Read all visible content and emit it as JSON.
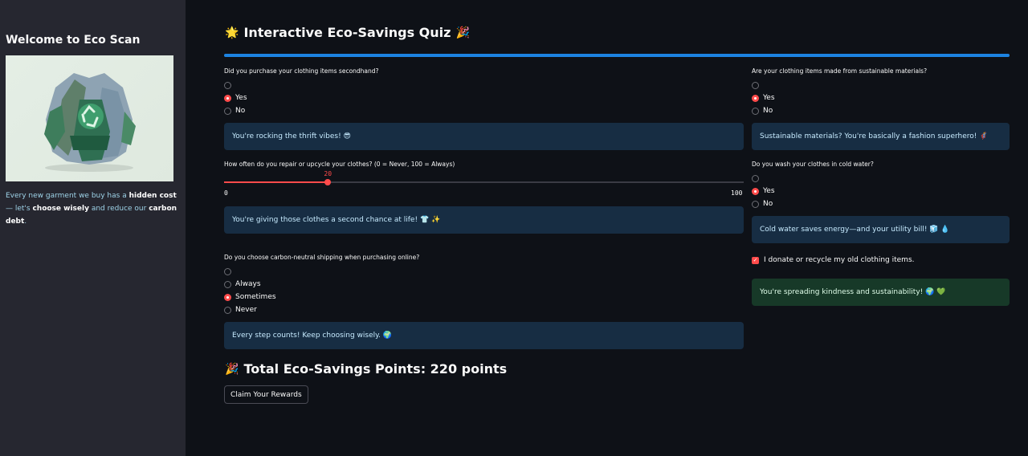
{
  "sidebar": {
    "title": "Welcome to Eco Scan",
    "text": {
      "p1": "Every new garment we buy has a ",
      "b1": "hidden cost",
      "p2": " — let's ",
      "b2": "choose wisely",
      "p3": " and reduce our ",
      "b3": "carbon debt",
      "p4": "."
    }
  },
  "main": {
    "title": "Interactive Eco-Savings Quiz",
    "title_emoji_left": "🌟",
    "title_emoji_right": "🎉",
    "progress": 1.0,
    "q1": {
      "label": "Did you purchase your clothing items secondhand?",
      "options": [
        "",
        "Yes",
        "No"
      ],
      "selected": "Yes",
      "feedback": "You're rocking the thrift vibes! 😎"
    },
    "q2": {
      "label": "How often do you repair or upcycle your clothes? (0 = Never, 100 = Always)",
      "value": "20",
      "min": "0",
      "max": "100",
      "feedback": "You're giving those clothes a second chance at life! 👕 ✨"
    },
    "q3": {
      "label": "Do you choose carbon-neutral shipping when purchasing online?",
      "options": [
        "",
        "Always",
        "Sometimes",
        "Never"
      ],
      "selected": "Sometimes",
      "feedback": "Every step counts! Keep choosing wisely. 🌍"
    },
    "q4": {
      "label": "Are your clothing items made from sustainable materials?",
      "options": [
        "",
        "Yes",
        "No"
      ],
      "selected": "Yes",
      "feedback": "Sustainable materials? You're basically a fashion superhero! 🦸"
    },
    "q5": {
      "label": "Do you wash your clothes in cold water?",
      "options": [
        "",
        "Yes",
        "No"
      ],
      "selected": "Yes",
      "feedback": "Cold water saves energy—and your utility bill! 🧊 💧"
    },
    "q6": {
      "label": "I donate or recycle my old clothing items.",
      "checked": true,
      "feedback": "You're spreading kindness and sustainability! 🌍 💚"
    },
    "total": {
      "emoji": "🎉",
      "label": "Total Eco-Savings Points: 220 points"
    },
    "claim_button": "Claim Your Rewards"
  },
  "colors": {
    "background": "#0e1117",
    "sidebar": "#262730",
    "accent": "#ff4b4b",
    "progress": "#1c83e1",
    "info_bg": "#172d43",
    "success_bg": "#173928"
  }
}
